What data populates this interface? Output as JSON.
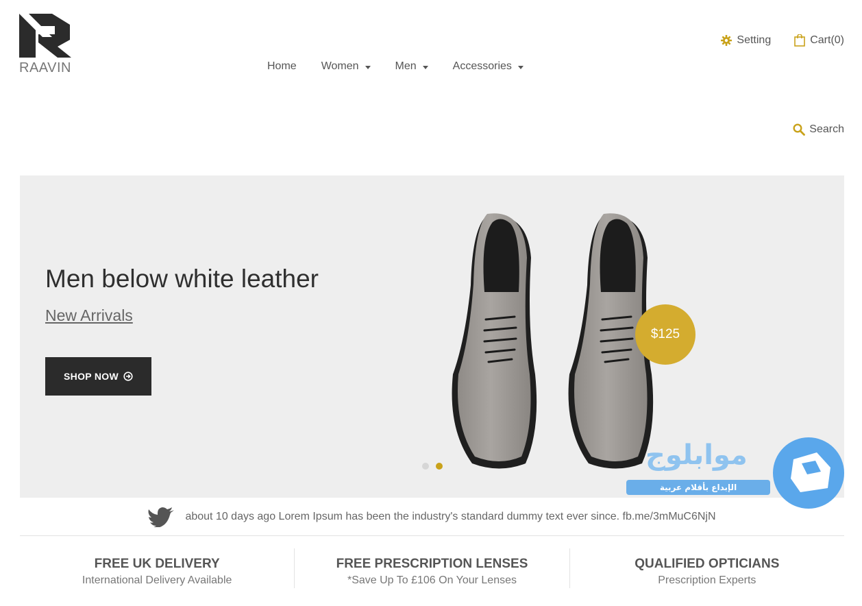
{
  "brand": {
    "name": "RAAVIN"
  },
  "nav": {
    "items": [
      {
        "label": "Home",
        "dropdown": false
      },
      {
        "label": "Women",
        "dropdown": true
      },
      {
        "label": "Men",
        "dropdown": true
      },
      {
        "label": "Accessories",
        "dropdown": true
      }
    ]
  },
  "topbar": {
    "setting_label": "Setting",
    "cart_label": "Cart(0)"
  },
  "search": {
    "label": "Search"
  },
  "hero": {
    "title": "Men below white leather",
    "subtitle": "New Arrivals",
    "button_label": "SHOP NOW",
    "price": "$125",
    "slides": 2,
    "active_slide": 2
  },
  "watermark": {
    "title": "موابلوج",
    "tagline": "الإبداع بأقلام عربية"
  },
  "tweet": {
    "text": "about 10 days ago Lorem Ipsum has been the industry's standard dummy text ever since. fb.me/3mMuC6NjN"
  },
  "features": [
    {
      "title": "FREE UK DELIVERY",
      "subtitle": "International Delivery Available"
    },
    {
      "title": "FREE PRESCRIPTION LENSES",
      "subtitle": "*Save Up To £106 On Your Lenses"
    },
    {
      "title": "QUALIFIED OPTICIANS",
      "subtitle": "Prescription Experts"
    }
  ],
  "colors": {
    "accent": "#d4ac2f",
    "dot_active": "#c9a21a",
    "button_bg": "#2b2b2b",
    "hero_bg": "#eeeeee"
  },
  "icons": {
    "setting": "gear-icon",
    "cart": "shopping-bag-icon",
    "search": "search-icon",
    "button": "circle-arrow-right-icon",
    "tweet": "twitter-bird-icon"
  }
}
